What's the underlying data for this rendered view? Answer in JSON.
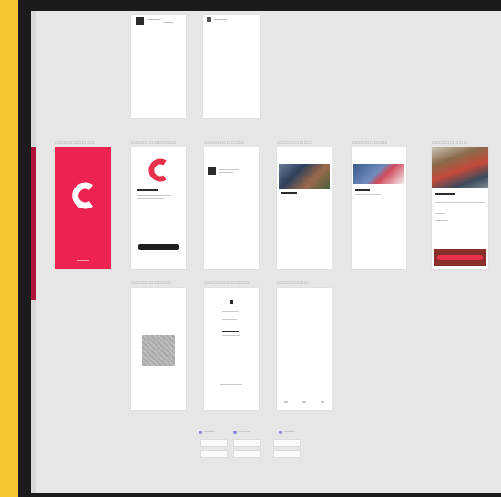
{
  "colors": {
    "frame": "#f7c531",
    "canvas": "#e6e6e6",
    "brand_red": "#ed2250",
    "dark": "#1e1e1e"
  },
  "icons": [
    "app-logo-c-icon",
    "qr-code-icon",
    "image-placeholder-icon"
  ],
  "artboards": {
    "top": [
      {
        "id": "screen-top-1"
      },
      {
        "id": "screen-top-2"
      }
    ],
    "middle": [
      {
        "id": "splash"
      },
      {
        "id": "welcome"
      },
      {
        "id": "list"
      },
      {
        "id": "feed"
      },
      {
        "id": "detail"
      },
      {
        "id": "product"
      }
    ],
    "bottom": [
      {
        "id": "qr"
      },
      {
        "id": "form"
      },
      {
        "id": "blank"
      }
    ]
  }
}
